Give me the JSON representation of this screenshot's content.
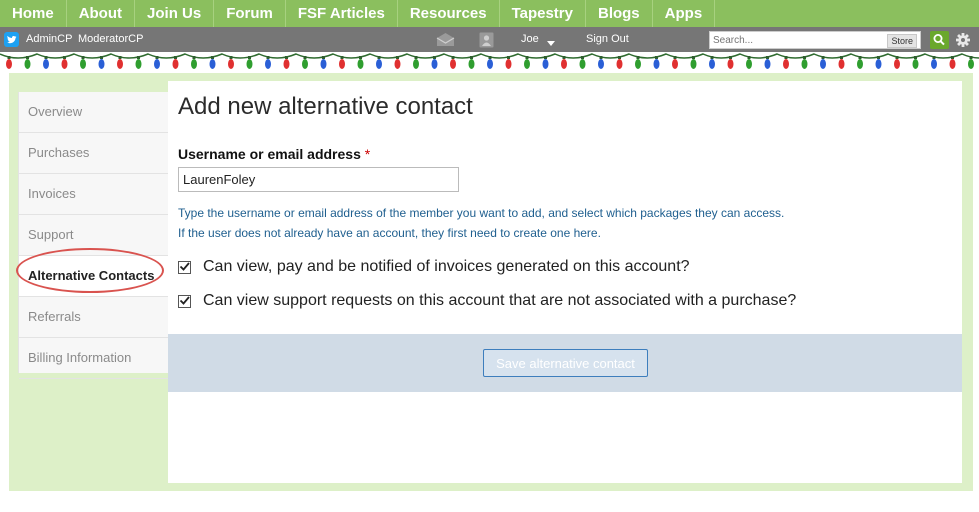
{
  "topnav": {
    "items": [
      "Home",
      "About",
      "Join Us",
      "Forum",
      "FSF Articles",
      "Resources",
      "Tapestry",
      "Blogs",
      "Apps"
    ]
  },
  "subbar": {
    "admin": "AdminCP",
    "moderator": "ModeratorCP",
    "user": "Joe",
    "signout": "Sign Out"
  },
  "search": {
    "placeholder": "Search...",
    "store_label": "Store"
  },
  "sidebar": {
    "items": [
      "Overview",
      "Purchases",
      "Invoices",
      "Support",
      "Alternative Contacts",
      "Referrals",
      "Billing Information"
    ],
    "active_index": 4
  },
  "form": {
    "title": "Add new alternative contact",
    "field_label": "Username or email address",
    "required_marker": "*",
    "input_value": "LaurenFoley",
    "hint1": "Type the username or email address of the member you want to add, and select which packages they can access.",
    "hint2": "If the user does not already have an account, they first need to create one here.",
    "check1": "Can view, pay and be notified of invoices generated on this account?",
    "check2": "Can view support requests on this account that are not associated with a purchase?",
    "submit": "Save alternative contact"
  },
  "colors": {
    "nav_green": "#8bbf5e",
    "subbar_gray": "#767676",
    "highlight_red": "#d9534f",
    "link_blue": "#1f5f8f"
  }
}
